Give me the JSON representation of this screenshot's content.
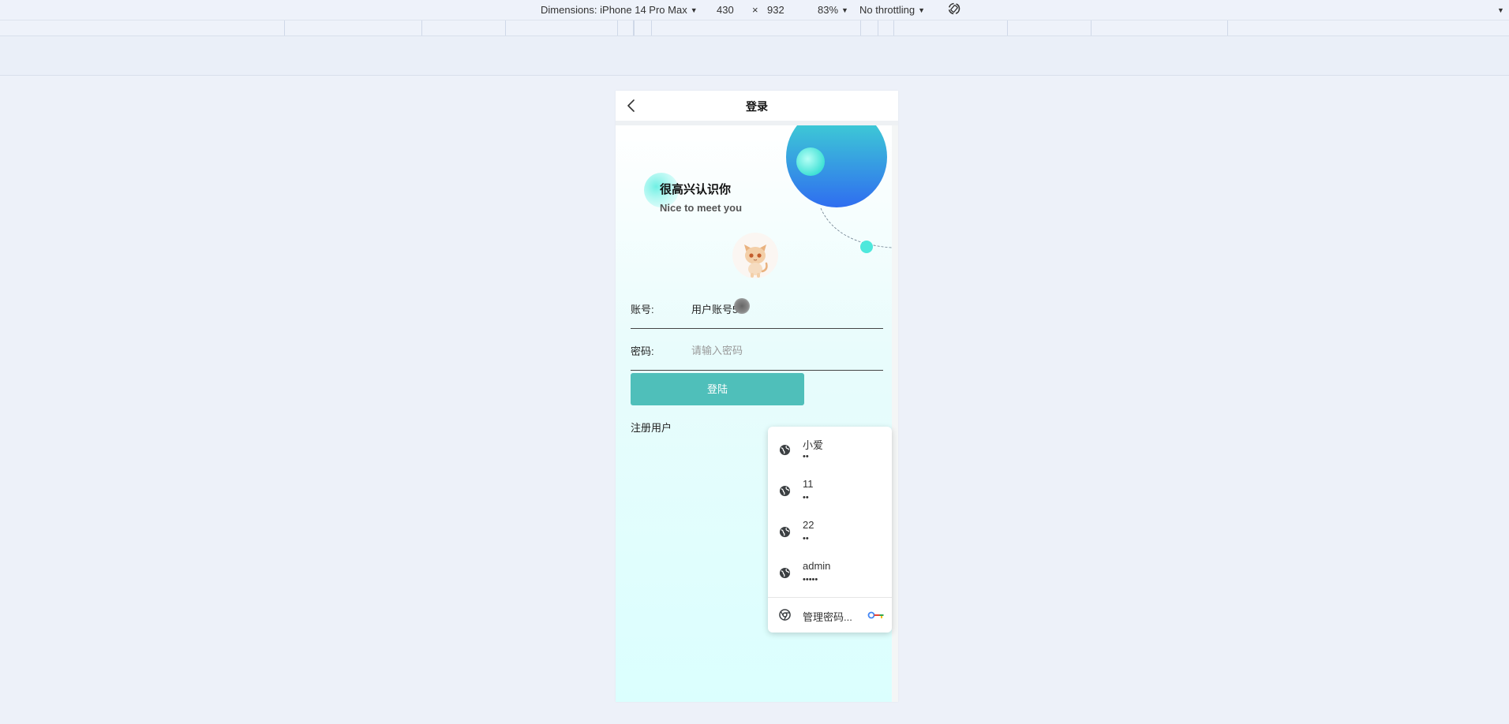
{
  "devtools": {
    "device_label": "Dimensions: iPhone 14 Pro Max",
    "width": "430",
    "times": "×",
    "height": "932",
    "zoom": "83%",
    "throttling": "No throttling",
    "rotate_icon": "rotate-icon",
    "more_icon": "chevron-down-icon"
  },
  "nav": {
    "title": "登录",
    "back_icon": "back-arrow-icon"
  },
  "hero": {
    "greeting_cn": "很高兴认识你",
    "greeting_en": "Nice to meet you",
    "avatar_icon": "cat-avatar"
  },
  "form": {
    "account_label": "账号:",
    "account_value": "用户账号5",
    "password_label": "密码:",
    "password_placeholder": "请输入密码",
    "login_button": "登陆",
    "register_link": "注册用户"
  },
  "password_popup": {
    "accounts": [
      {
        "user": "小爱",
        "mask": "••"
      },
      {
        "user": "11",
        "mask": "••"
      },
      {
        "user": "22",
        "mask": "••"
      },
      {
        "user": "admin",
        "mask": "•••••"
      }
    ],
    "manage_label": "管理密码...",
    "globe_icon": "globe-icon",
    "chrome_icon": "chrome-icon",
    "key_icon": "key-icon"
  },
  "colors": {
    "accent": "#4fbfba",
    "circle_teal": "#40dcd0",
    "circle_blue": "#2f6df0",
    "page_bg": "#edf1f9"
  }
}
